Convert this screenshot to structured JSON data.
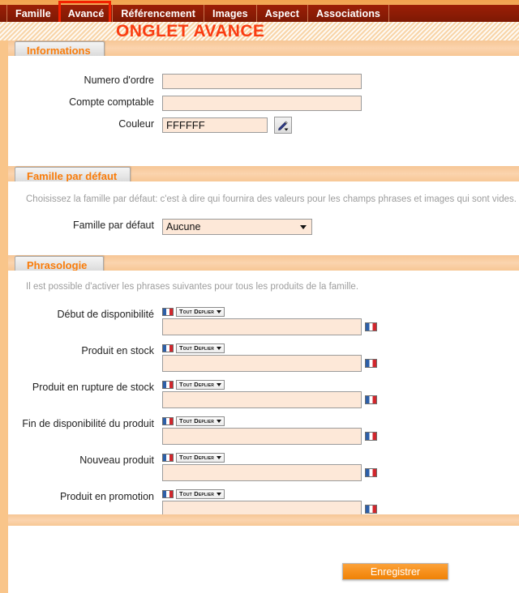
{
  "tabs": [
    {
      "label": "Famille",
      "active": false
    },
    {
      "label": "Avancé",
      "active": true
    },
    {
      "label": "Référencement",
      "active": false
    },
    {
      "label": "Images",
      "active": false
    },
    {
      "label": "Aspect",
      "active": false
    },
    {
      "label": "Associations",
      "active": false
    }
  ],
  "page": {
    "title": "ONGLET AVANCE",
    "title_color": "#fa3c12",
    "accent_color": "#f97c0a",
    "tabbar_color": "#8d1c05",
    "annotation_color": "#f42000"
  },
  "sections": {
    "informations": {
      "header": "Informations",
      "fields": {
        "numero_ordre": {
          "label": "Numero d'ordre",
          "value": "",
          "placeholder": ""
        },
        "compte_comptable": {
          "label": "Compte comptable",
          "value": "",
          "placeholder": ""
        },
        "couleur": {
          "label": "Couleur",
          "value": "FFFFFF",
          "placeholder": ""
        }
      },
      "picker_icon": "pencil-icon"
    },
    "famille_defaut": {
      "header": "Famille par défaut",
      "help": "Choisissez la famille par défaut: c'est à dire qui fournira des valeurs pour les champs phrases et images qui sont vides.",
      "field_label": "Famille par défaut",
      "selected": "Aucune",
      "options": [
        "Aucune"
      ]
    },
    "phrasologie": {
      "header": "Phrasologie",
      "help": "Il est possible d'activer les phrases suivantes pour tous les produits de la famille.",
      "expand_label": "Tout Deplier",
      "flag_icon": "french-flag-icon",
      "rows": [
        {
          "label": "Début de disponibilité",
          "value": ""
        },
        {
          "label": "Produit en stock",
          "value": ""
        },
        {
          "label": "Produit en rupture de stock",
          "value": ""
        },
        {
          "label": "Fin de disponibilité du produit",
          "value": ""
        },
        {
          "label": "Nouveau produit",
          "value": ""
        },
        {
          "label": "Produit en promotion",
          "value": ""
        }
      ]
    }
  },
  "footer": {
    "save_label": "Enregistrer"
  }
}
